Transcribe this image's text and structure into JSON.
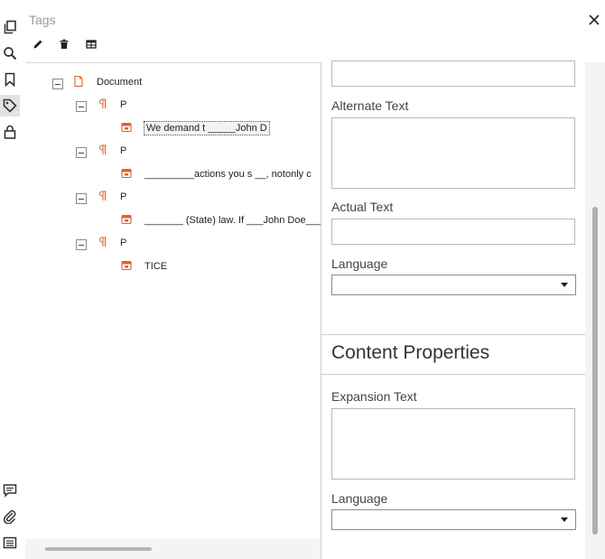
{
  "panel": {
    "title": "Tags"
  },
  "rail": {
    "top_icons": [
      "pages-icon",
      "search-icon",
      "bookmark-icon",
      "tag-icon",
      "lock-icon"
    ],
    "bottom_icons": [
      "comment-icon",
      "attachment-icon",
      "form-fields-icon"
    ],
    "active": "tag-icon"
  },
  "toolbar": [
    "edit-icon",
    "delete-icon",
    "table-icon"
  ],
  "tree": {
    "root": "Document",
    "nodes": [
      {
        "tag": "P",
        "content": "We demand t _____John D"
      },
      {
        "tag": "P",
        "content": "_________actions you s __, notonly c"
      },
      {
        "tag": "P",
        "content": "_______ (State) law. If ___John Doe___"
      },
      {
        "tag": "P",
        "content": "TICE"
      }
    ]
  },
  "properties": {
    "alternate_text_label": "Alternate Text",
    "actual_text_label": "Actual Text",
    "language_label": "Language",
    "content_heading": "Content Properties",
    "expansion_text_label": "Expansion Text",
    "language2_label": "Language",
    "language_value": "",
    "language2_value": ""
  },
  "colors": {
    "accent": "#e0622a",
    "rail_active": "#e2e2e2"
  }
}
